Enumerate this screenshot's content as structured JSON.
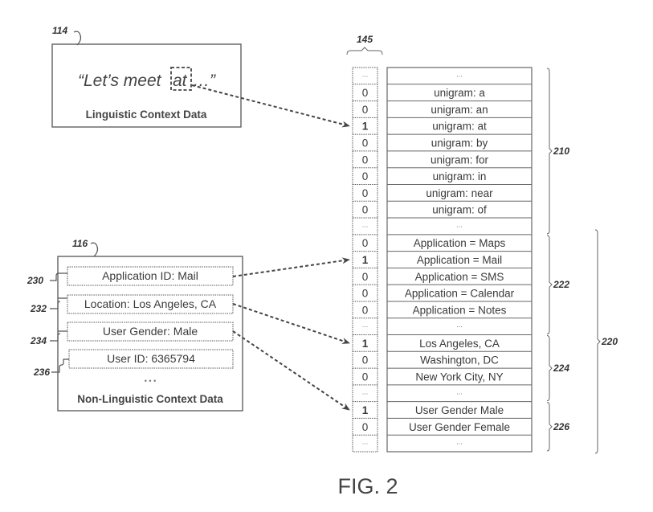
{
  "figure_label": "FIG. 2",
  "vector_ref": "145",
  "linguistic_box": {
    "ref": "114",
    "quote_prefix": "“Let’s meet",
    "highlighted_word": "at",
    "quote_suffix": "…”",
    "title": "Linguistic Context Data"
  },
  "non_linguistic_box": {
    "ref": "116",
    "title": "Non-Linguistic Context Data",
    "ellipsis": "• • •",
    "items": [
      {
        "ref": "230",
        "label": "Application ID:  Mail"
      },
      {
        "ref": "232",
        "label": "Location:  Los Angeles, CA"
      },
      {
        "ref": "234",
        "label": "User Gender:  Male"
      },
      {
        "ref": "236",
        "label": "User ID:  6365794"
      }
    ]
  },
  "feature_vector": {
    "rows": [
      {
        "bit": "...",
        "feature": "..."
      },
      {
        "bit": "0",
        "feature": "unigram: a"
      },
      {
        "bit": "0",
        "feature": "unigram: an"
      },
      {
        "bit": "1",
        "feature": "unigram: at"
      },
      {
        "bit": "0",
        "feature": "unigram: by"
      },
      {
        "bit": "0",
        "feature": "unigram: for"
      },
      {
        "bit": "0",
        "feature": "unigram: in"
      },
      {
        "bit": "0",
        "feature": "unigram: near"
      },
      {
        "bit": "0",
        "feature": "unigram: of"
      },
      {
        "bit": "...",
        "feature": "..."
      },
      {
        "bit": "0",
        "feature": "Application = Maps"
      },
      {
        "bit": "1",
        "feature": "Application = Mail"
      },
      {
        "bit": "0",
        "feature": "Application = SMS"
      },
      {
        "bit": "0",
        "feature": "Application = Calendar"
      },
      {
        "bit": "0",
        "feature": "Application = Notes"
      },
      {
        "bit": "...",
        "feature": "..."
      },
      {
        "bit": "1",
        "feature": "Los Angeles, CA"
      },
      {
        "bit": "0",
        "feature": "Washington, DC"
      },
      {
        "bit": "0",
        "feature": "New York City, NY"
      },
      {
        "bit": "...",
        "feature": "..."
      },
      {
        "bit": "1",
        "feature": "User Gender Male"
      },
      {
        "bit": "0",
        "feature": "User Gender Female"
      },
      {
        "bit": "...",
        "feature": "..."
      }
    ]
  },
  "groups": [
    {
      "ref": "210",
      "first_row": 0,
      "last_row": 9
    },
    {
      "ref": "222",
      "first_row": 10,
      "last_row": 15
    },
    {
      "ref": "224",
      "first_row": 16,
      "last_row": 19
    },
    {
      "ref": "226",
      "first_row": 20,
      "last_row": 22
    }
  ],
  "super_group": {
    "ref": "220",
    "first_row": 10,
    "last_row": 22
  },
  "arrows": [
    {
      "from": "highlighted_word",
      "to_row": 3
    },
    {
      "from": "230",
      "to_row": 11
    },
    {
      "from": "232",
      "to_row": 16
    },
    {
      "from": "234",
      "to_row": 20
    }
  ]
}
